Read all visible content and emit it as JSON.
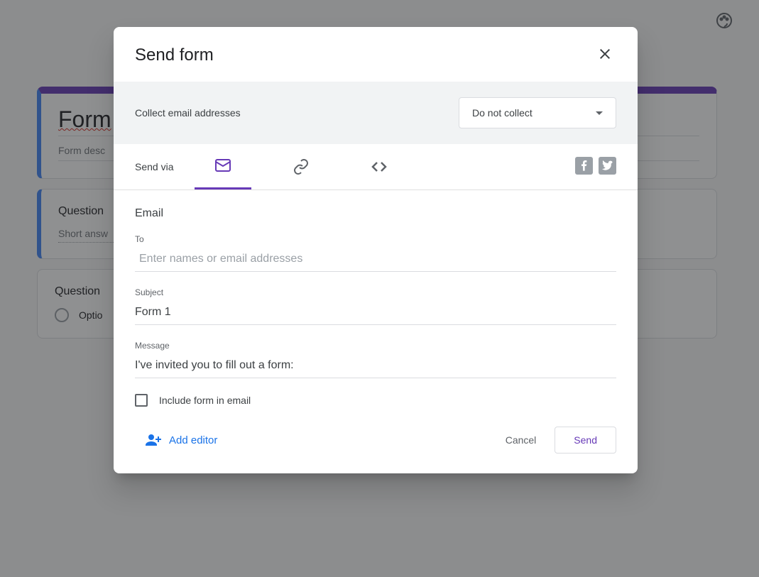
{
  "background": {
    "form_title": "Form",
    "form_desc": "Form desc",
    "question1": {
      "title": "Question",
      "hint": "Short answ"
    },
    "question2": {
      "title": "Question",
      "option": "Optio"
    }
  },
  "modal": {
    "title": "Send form",
    "collect": {
      "label": "Collect email addresses",
      "selected": "Do not collect"
    },
    "send_via_label": "Send via",
    "email_section": {
      "heading": "Email",
      "to": {
        "label": "To",
        "placeholder": "Enter names or email addresses",
        "value": ""
      },
      "subject": {
        "label": "Subject",
        "value": "Form 1"
      },
      "message": {
        "label": "Message",
        "value": "I've invited you to fill out a form:"
      },
      "include_checkbox": "Include form in email"
    },
    "footer": {
      "add_editor": "Add editor",
      "cancel": "Cancel",
      "send": "Send"
    }
  }
}
